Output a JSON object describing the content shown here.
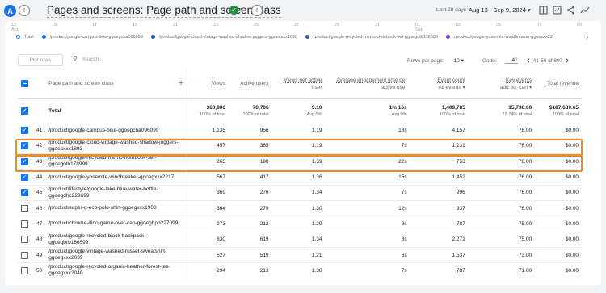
{
  "header": {
    "avatar_letter": "A",
    "add_label": "+",
    "title": "Pages and screens: Page path and screen class",
    "status_check": "✓",
    "caret": "▾",
    "add_comparison": "+",
    "date_label": "Last 28 days",
    "date_range": "Aug 13 - Sep 9, 2024",
    "date_caret": "▾"
  },
  "chart_axis": {
    "ticks": [
      "13\nAug",
      "15",
      "17",
      "19",
      "21",
      "23",
      "25",
      "27",
      "29",
      "31",
      "01\nSep",
      "03",
      "05",
      "07",
      "09"
    ]
  },
  "legend": {
    "items": [
      {
        "label": "Total",
        "color": "#ffffff"
      },
      {
        "label": "/product/google-campus-bike-ggoegcba096099",
        "color": "#1a73e8"
      },
      {
        "label": "/product/google-cloud-vintage-washed-shadow-joggers-ggoecxxx1893",
        "color": "#1557b0"
      },
      {
        "label": "/product/google-recycled-memo-notebook-set-ggoegolb178999",
        "color": "#3c4fa3"
      },
      {
        "label": "/product/google-yosemite-windbreaker-ggoexxx22",
        "color": "#7b3fb8"
      }
    ],
    "next": "›"
  },
  "controls": {
    "plot_rows": "Plot rows",
    "search_placeholder": "Search...",
    "rows_per_page_label": "Rows per page:",
    "rows_per_page_value": "10",
    "goto_label": "Go to:",
    "goto_value": "41",
    "pagination": "41-50 of 897",
    "prev": "‹",
    "next": "›"
  },
  "table": {
    "dimension_header": "Page path and screen class",
    "columns": [
      {
        "label": "Views",
        "sub": ""
      },
      {
        "label": "Active users",
        "sub": ""
      },
      {
        "label": "Views per active user",
        "sub": ""
      },
      {
        "label": "Average engagement time per active user",
        "sub": ""
      },
      {
        "label": "Event count",
        "sub": "All events ▾"
      },
      {
        "label": "Key events",
        "sub": "add_to_cart ▾"
      },
      {
        "label": "Total revenue",
        "sub": ""
      }
    ],
    "total": {
      "label": "Total",
      "values": [
        "360,806",
        "70,706",
        "5.10",
        "1m 16s",
        "1,409,785",
        "15,736.00",
        "$187,689.65"
      ],
      "subs": [
        "100% of total",
        "100% of total",
        "Avg 0%",
        "Avg 0%",
        "100% of total",
        "13.74% of total",
        "100% of total"
      ]
    },
    "rows": [
      {
        "idx": "41",
        "checked": true,
        "path": "/product/google-campus-bike-ggoegcba096099",
        "values": [
          "1,135",
          "956",
          "1.19",
          "13s",
          "4,157",
          "76.00",
          "$0.00"
        ]
      },
      {
        "idx": "42",
        "checked": true,
        "path": "/product/google-cloud-vintage-washed-shadow-joggers-ggoecxxx1893",
        "values": [
          "457",
          "385",
          "1.19",
          "7s",
          "1,231",
          "76.00",
          "$0.00"
        ]
      },
      {
        "idx": "43",
        "checked": true,
        "path": "/product/google-recycled-memo-notebook-set-ggoegolb178999",
        "values": [
          "265",
          "190",
          "1.39",
          "22s",
          "753",
          "76.00",
          "$0.00"
        ]
      },
      {
        "idx": "44",
        "checked": true,
        "path": "/product/google-yosemite-windbreaker-ggoegxxx2217",
        "values": [
          "567",
          "417",
          "1.36",
          "15s",
          "1,452",
          "76.00",
          "$0.00"
        ]
      },
      {
        "idx": "45",
        "checked": true,
        "path": "/product/lifestyle/google-lake-blue-water-bottle-ggoegdhc229699",
        "values": [
          "369",
          "276",
          "1.34",
          "7s",
          "996",
          "76.00",
          "$0.00"
        ]
      },
      {
        "idx": "46",
        "checked": false,
        "path": "/product/super-g-eco-polo-shirt-ggoegxxx1900",
        "values": [
          "364",
          "279",
          "1.30",
          "12s",
          "937",
          "76.00",
          "$0.00"
        ]
      },
      {
        "idx": "47",
        "checked": false,
        "path": "/product/chrome-dino-game-over-cap-ggoeghpb227099",
        "values": [
          "273",
          "212",
          "1.29",
          "8s",
          "787",
          "75.00",
          "$0.00"
        ]
      },
      {
        "idx": "48",
        "checked": false,
        "path": "/product/google-recycled-black-backpack-ggoegbrb186599",
        "values": [
          "830",
          "619",
          "1.34",
          "8s",
          "2,271",
          "75.00",
          "$0.00"
        ]
      },
      {
        "idx": "49",
        "checked": false,
        "path": "/product/google-vintage-washed-russet-sweatshirt-ggoegxxx2039",
        "values": [
          "627",
          "519",
          "1.21",
          "6s",
          "1,537",
          "73.00",
          "$0.00"
        ]
      },
      {
        "idx": "50",
        "checked": false,
        "path": "/product/google-recycled-organic-heather-forest-tee-ggoegxxx2040",
        "values": [
          "294",
          "213",
          "1.38",
          "7s",
          "787",
          "71.00",
          "$0.00"
        ]
      }
    ]
  },
  "colors": {
    "accent": "#1a73e8",
    "highlight": "#ef8a2f"
  }
}
